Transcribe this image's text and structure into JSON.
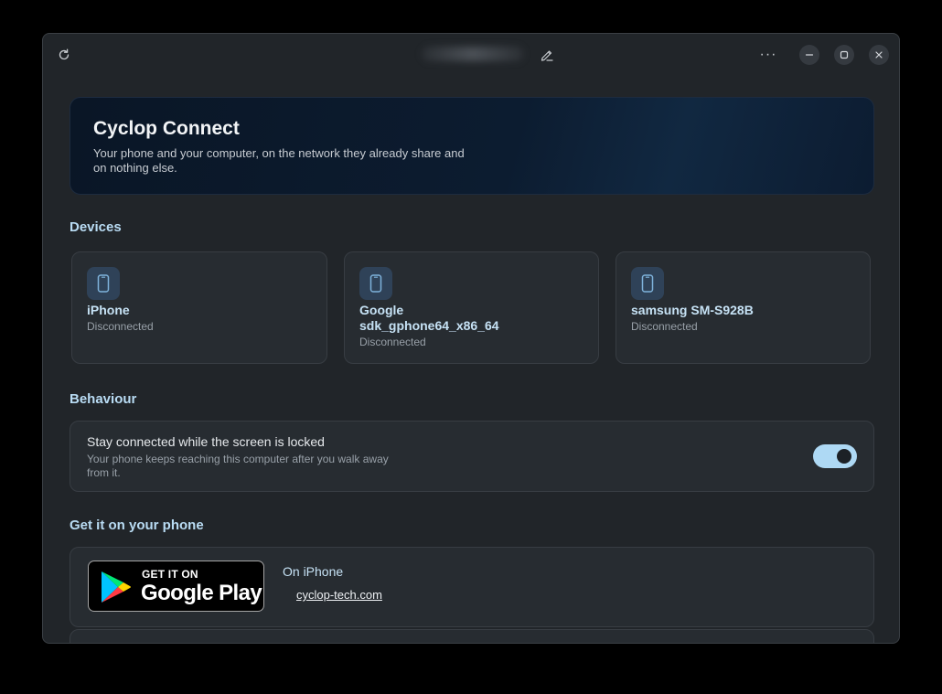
{
  "titlebar": {
    "refresh_icon": "refresh-icon",
    "edit_icon": "edit-icon",
    "more_label": "···",
    "minimize_icon": "minimize-icon",
    "maximize_icon": "maximize-icon",
    "close_icon": "close-icon"
  },
  "hero": {
    "title": "Cyclop Connect",
    "subtitle": "Your phone and your computer, on the network they already share and on nothing else."
  },
  "devices": {
    "title": "Devices",
    "items": [
      {
        "name": "iPhone",
        "status": "Disconnected",
        "icon": "phone-icon"
      },
      {
        "name": "Google sdk_gphone64_x86_64",
        "status": "Disconnected",
        "icon": "phone-icon"
      },
      {
        "name": "samsung SM-S928B",
        "status": "Disconnected",
        "icon": "phone-icon"
      }
    ]
  },
  "behaviour": {
    "title": "Behaviour",
    "setting_title": "Stay connected while the screen is locked",
    "setting_desc": "Your phone keeps reaching this computer after you walk away from it.",
    "toggle_on": true
  },
  "get_app": {
    "title": "Get it on your phone",
    "badge_small": "GET IT ON",
    "badge_big": "Google Play",
    "iphone_label": "On iPhone",
    "link": "cyclop-tech.com"
  },
  "colors": {
    "accent": "#b9dcf4",
    "toggle": "#aed9f4",
    "card": "#272c31",
    "window": "#212529"
  }
}
